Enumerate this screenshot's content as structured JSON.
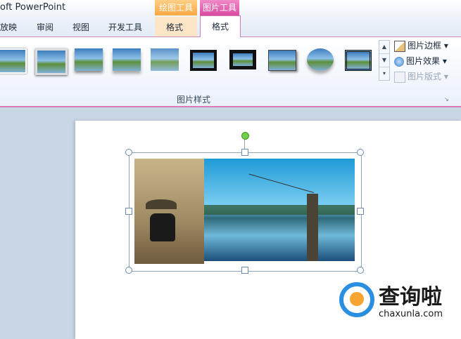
{
  "window": {
    "title": "oft PowerPoint"
  },
  "context_headers": {
    "drawing_tools": "绘图工具",
    "picture_tools": "图片工具"
  },
  "tabs": [
    {
      "label": "放映"
    },
    {
      "label": "审阅"
    },
    {
      "label": "视图"
    },
    {
      "label": "开发工具"
    },
    {
      "label": "格式",
      "context": "drawing"
    },
    {
      "label": "格式",
      "context": "picture",
      "active": true
    }
  ],
  "ribbon": {
    "group_label": "图片样式",
    "commands": {
      "border": "图片边框",
      "effects": "图片效果",
      "layout": "图片版式"
    }
  },
  "colors": {
    "accent_pink": "#d94aa0",
    "accent_orange": "#f7a741"
  },
  "watermark": {
    "brand": "查询啦",
    "url": "chaxunla.com"
  }
}
